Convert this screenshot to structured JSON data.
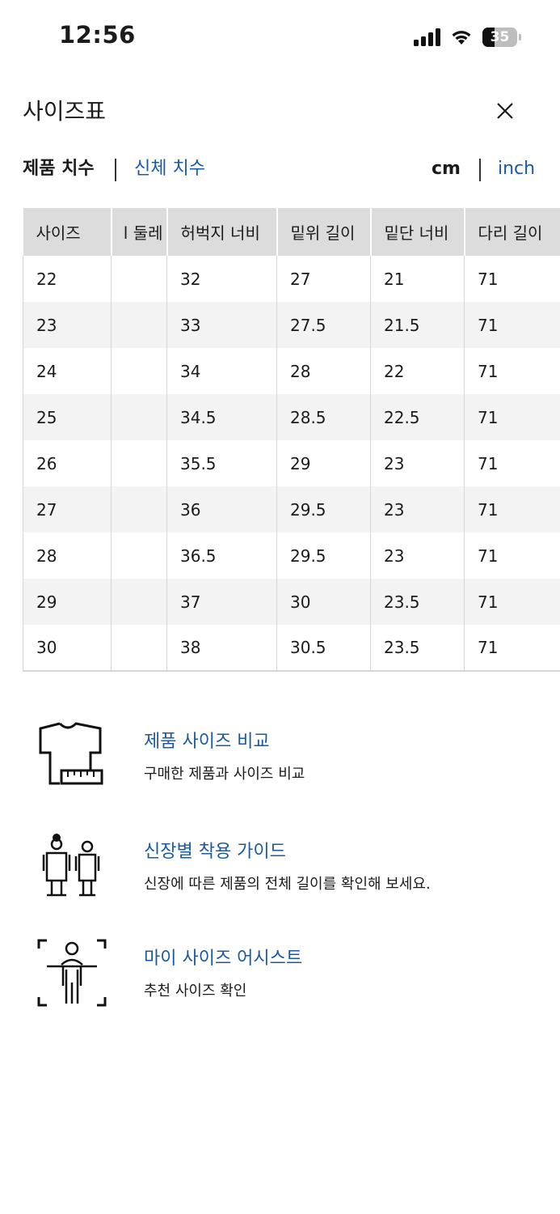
{
  "status_bar": {
    "time": "12:56",
    "battery": "35",
    "battery_level": 0.35
  },
  "header": {
    "title": "사이즈표"
  },
  "tabs": {
    "product": "제품 치수",
    "body": "신체 치수"
  },
  "units": {
    "cm": "cm",
    "inch": "inch"
  },
  "table": {
    "headers": [
      "사이즈",
      "l 둘레",
      "허벅지 너비",
      "밑위 길이",
      "밑단 너비",
      "다리 길이"
    ],
    "rows": [
      [
        "22",
        "",
        "32",
        "27",
        "21",
        "71"
      ],
      [
        "23",
        "",
        "33",
        "27.5",
        "21.5",
        "71"
      ],
      [
        "24",
        "",
        "34",
        "28",
        "22",
        "71"
      ],
      [
        "25",
        "",
        "34.5",
        "28.5",
        "22.5",
        "71"
      ],
      [
        "26",
        "",
        "35.5",
        "29",
        "23",
        "71"
      ],
      [
        "27",
        "",
        "36",
        "29.5",
        "23",
        "71"
      ],
      [
        "28",
        "",
        "36.5",
        "29.5",
        "23",
        "71"
      ],
      [
        "29",
        "",
        "37",
        "30",
        "23.5",
        "71"
      ],
      [
        "30",
        "",
        "38",
        "30.5",
        "23.5",
        "71"
      ]
    ]
  },
  "links": [
    {
      "title": "제품 사이즈 비교",
      "desc": "구매한 제품과 사이즈 비교",
      "icon": "tshirt-measure-icon"
    },
    {
      "title": "신장별 착용 가이드",
      "desc": "신장에 따른 제품의 전체 길이를 확인해 보세요.",
      "icon": "height-guide-icon"
    },
    {
      "title": "마이 사이즈 어시스트",
      "desc": "추천 사이즈 확인",
      "icon": "body-scan-icon"
    }
  ],
  "colors": {
    "accent": "#1a5aa1",
    "header_bg": "#dcdcdc",
    "stripe_bg": "#f3f3f3"
  }
}
